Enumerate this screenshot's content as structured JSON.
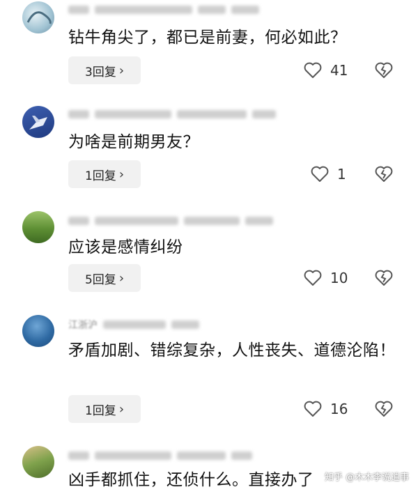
{
  "comments": [
    {
      "text": "钻牛角尖了，都已是前妻，何必如此？",
      "reply_label": "3回复",
      "likes": "41",
      "avatar": "abstract-avatar"
    },
    {
      "text": "为啥是前期男友？",
      "reply_label": "1回复",
      "likes": "1",
      "avatar": "jet-avatar"
    },
    {
      "text": "应该是感情纠纷",
      "reply_label": "5回复",
      "likes": "10",
      "avatar": "field-avatar"
    },
    {
      "text": "矛盾加剧、错综复杂，人性丧失、道德沦陷！",
      "reply_label": "1回复",
      "likes": "16",
      "avatar": "planet-avatar"
    },
    {
      "text": "凶手都抓住，还侦什么。直接办了",
      "avatar": "plant-avatar"
    }
  ],
  "meta_visible": [
    "江浙沪"
  ],
  "icons": {
    "chevron": "›",
    "like": "heart-icon",
    "dislike": "broken-heart-icon"
  },
  "watermark": "知乎 @木木李说逍事"
}
